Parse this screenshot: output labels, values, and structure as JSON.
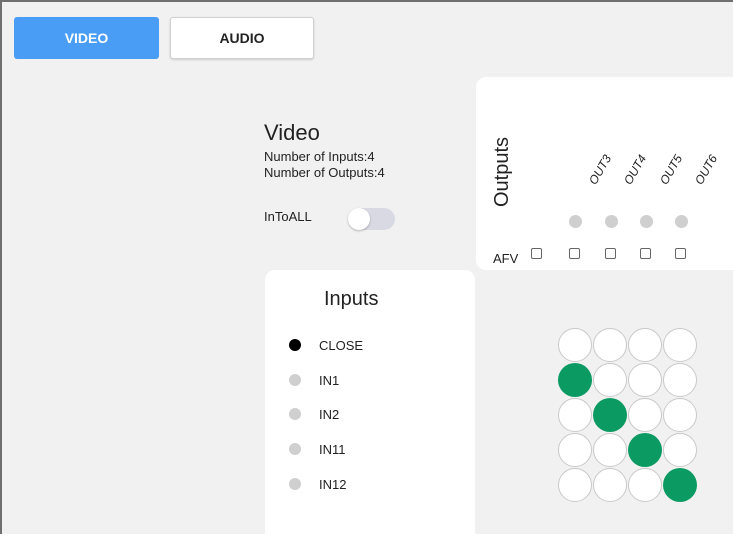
{
  "tabs": {
    "video": "VIDEO",
    "audio": "AUDIO"
  },
  "info": {
    "title": "Video",
    "num_inputs": "Number of Inputs:4",
    "num_outputs": "Number of Outputs:4",
    "intoall_label": "InToALL",
    "intoall_on": false
  },
  "outputs": {
    "title": "Outputs",
    "afv_label": "AFV",
    "labels": [
      "OUT3",
      "OUT4",
      "OUT5",
      "OUT6"
    ]
  },
  "inputs": {
    "title": "Inputs",
    "items": [
      {
        "label": "CLOSE",
        "selected": true
      },
      {
        "label": "IN1",
        "selected": false
      },
      {
        "label": "IN2",
        "selected": false
      },
      {
        "label": "IN11",
        "selected": false
      },
      {
        "label": "IN12",
        "selected": false
      }
    ]
  },
  "matrix": {
    "active": [
      [
        false,
        false,
        false,
        false
      ],
      [
        true,
        false,
        false,
        false
      ],
      [
        false,
        true,
        false,
        false
      ],
      [
        false,
        false,
        true,
        false
      ],
      [
        false,
        false,
        false,
        true
      ]
    ]
  },
  "colors": {
    "active_tab": "#4a9df5",
    "active_cell": "#0b9a62",
    "selected_dot": "#000000",
    "unselected_dot": "#cfcfcf"
  }
}
